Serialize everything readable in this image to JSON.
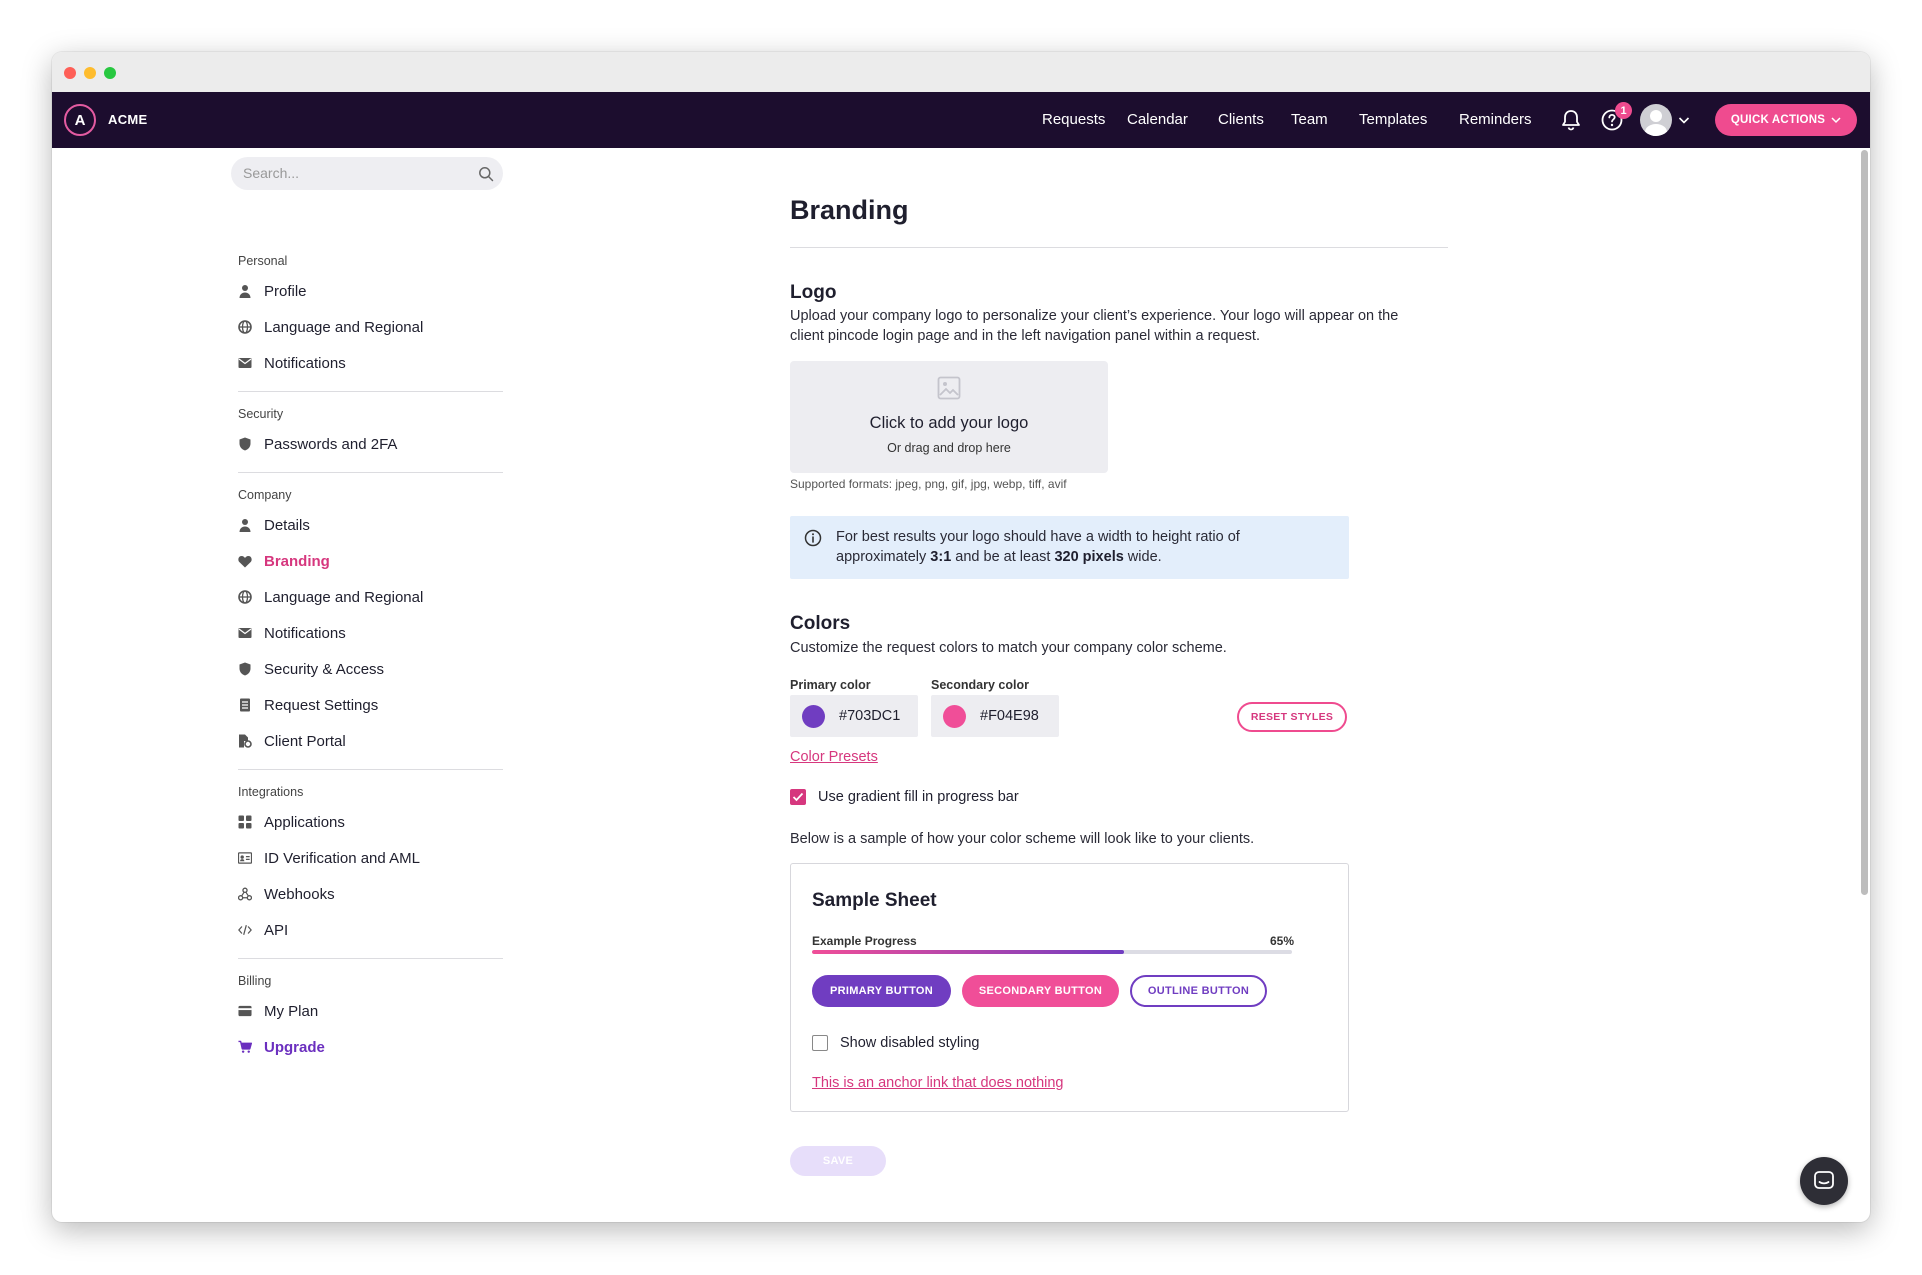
{
  "app": {
    "brand_name": "ACME",
    "brand_initial": "A"
  },
  "nav": {
    "items": [
      "Requests",
      "Calendar",
      "Clients",
      "Team",
      "Templates",
      "Reminders"
    ],
    "help_badge_count": "1",
    "quick_actions_label": "QUICK ACTIONS",
    "icons": [
      "bell-icon",
      "help-icon",
      "avatar",
      "chevron-down-icon"
    ]
  },
  "sidebar": {
    "search_placeholder": "Search...",
    "sections": {
      "personal": "Personal",
      "security": "Security",
      "company": "Company",
      "integrations": "Integrations",
      "billing": "Billing"
    },
    "items": {
      "profile": "Profile",
      "personal_language": "Language and Regional",
      "personal_notifications": "Notifications",
      "passwords": "Passwords and 2FA",
      "details": "Details",
      "branding": "Branding",
      "company_language": "Language and Regional",
      "company_notifications": "Notifications",
      "security_access": "Security & Access",
      "request_settings": "Request Settings",
      "client_portal": "Client Portal",
      "applications": "Applications",
      "id_verification": "ID Verification and AML",
      "webhooks": "Webhooks",
      "api": "API",
      "my_plan": "My Plan",
      "upgrade": "Upgrade"
    },
    "active_item": "Branding"
  },
  "main": {
    "title": "Branding",
    "logo": {
      "heading": "Logo",
      "description_line1": "Upload your company logo to personalize your client’s experience. Your logo will appear on the",
      "description_line2": "client pincode login page and in the left navigation panel within a request.",
      "upload_title": "Click to add your logo",
      "upload_subtitle": "Or drag and drop here",
      "formats": "Supported formats: jpeg, png, gif, jpg, webp, tiff, avif",
      "info_pre": "For best results your logo should have a width to height ratio of",
      "info_approx": "approximately ",
      "info_ratio": "3:1",
      "info_mid": " and be at least ",
      "info_pixels": "320 pixels",
      "info_post": " wide."
    },
    "colors": {
      "heading": "Colors",
      "description": "Customize the request colors to match your company color scheme.",
      "primary_label": "Primary color",
      "primary_value": "#703DC1",
      "secondary_label": "Secondary color",
      "secondary_value": "#F04E98",
      "reset_label": "RESET STYLES",
      "presets_link": "Color Presets",
      "gradient_label": "Use gradient fill in progress bar",
      "gradient_checked": true,
      "sample_intro": "Below is a sample of how your color scheme will look like to your clients."
    },
    "sample": {
      "title": "Sample Sheet",
      "progress_label": "Example Progress",
      "progress_percent_text": "65%",
      "progress_value": 0.65,
      "primary_button": "PRIMARY BUTTON",
      "secondary_button": "SECONDARY BUTTON",
      "outline_button": "OUTLINE BUTTON",
      "disabled_label": "Show disabled styling",
      "disabled_checked": false,
      "anchor_link": "This is an anchor link that does nothing"
    },
    "save_label": "SAVE"
  },
  "colors": {
    "nav_bg": "#1c0d2e",
    "accent_pink": "#ef4b8f",
    "link_pink": "#d6377e",
    "primary": "#703DC1",
    "secondary": "#F04E98"
  }
}
